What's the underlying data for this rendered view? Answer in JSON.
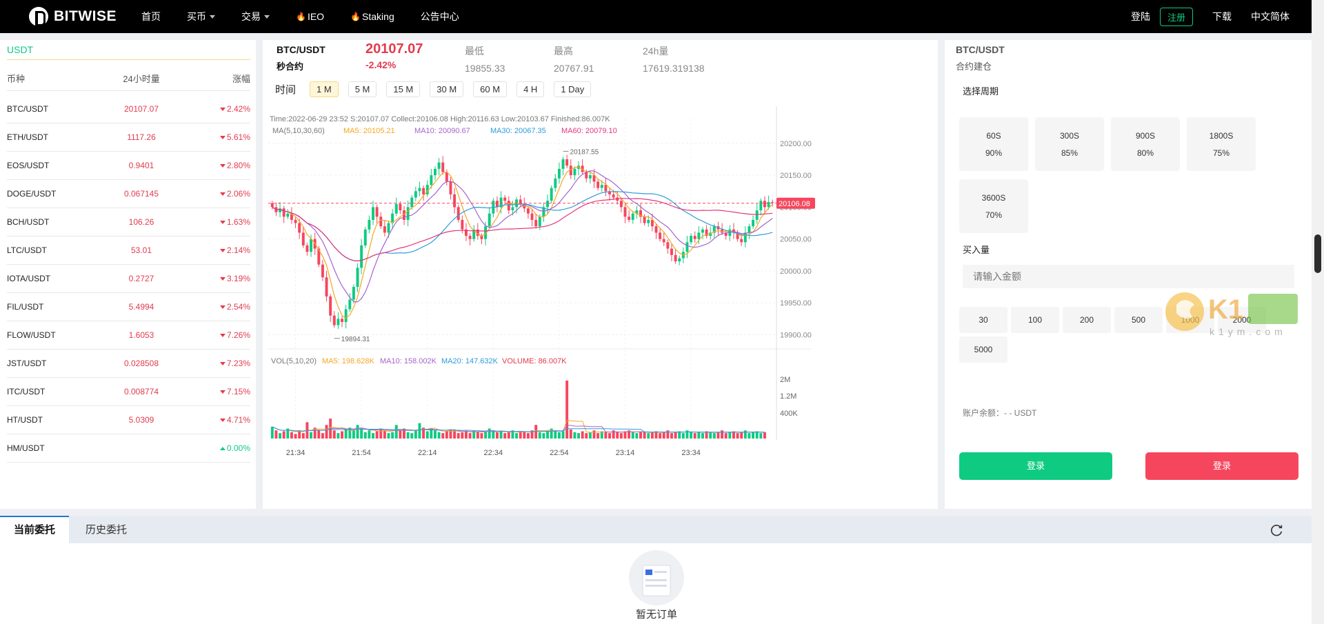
{
  "header": {
    "logo_text": "BITWISE",
    "nav": [
      {
        "label": "首页",
        "dropdown": false,
        "fire": false
      },
      {
        "label": "买币",
        "dropdown": true,
        "fire": false
      },
      {
        "label": "交易",
        "dropdown": true,
        "fire": false
      },
      {
        "label": "IEO",
        "dropdown": false,
        "fire": true
      },
      {
        "label": "Staking",
        "dropdown": false,
        "fire": true
      },
      {
        "label": "公告中心",
        "dropdown": false,
        "fire": false
      }
    ],
    "login": "登陆",
    "register": "注册",
    "download": "下载",
    "language": "中文简体"
  },
  "market": {
    "tab": "USDT",
    "headers": {
      "pair": "币种",
      "volume": "24小时量",
      "change": "涨幅"
    },
    "rows": [
      {
        "pair": "BTC/USDT",
        "price": "20107.07",
        "change": "2.42%",
        "dir": "down"
      },
      {
        "pair": "ETH/USDT",
        "price": "1117.26",
        "change": "5.61%",
        "dir": "down"
      },
      {
        "pair": "EOS/USDT",
        "price": "0.9401",
        "change": "2.80%",
        "dir": "down"
      },
      {
        "pair": "DOGE/USDT",
        "price": "0.067145",
        "change": "2.06%",
        "dir": "down"
      },
      {
        "pair": "BCH/USDT",
        "price": "106.26",
        "change": "1.63%",
        "dir": "down"
      },
      {
        "pair": "LTC/USDT",
        "price": "53.01",
        "change": "2.14%",
        "dir": "down"
      },
      {
        "pair": "IOTA/USDT",
        "price": "0.2727",
        "change": "3.19%",
        "dir": "down"
      },
      {
        "pair": "FIL/USDT",
        "price": "5.4994",
        "change": "2.54%",
        "dir": "down"
      },
      {
        "pair": "FLOW/USDT",
        "price": "1.6053",
        "change": "7.26%",
        "dir": "down"
      },
      {
        "pair": "JST/USDT",
        "price": "0.028508",
        "change": "7.23%",
        "dir": "down"
      },
      {
        "pair": "ITC/USDT",
        "price": "0.008774",
        "change": "7.15%",
        "dir": "down"
      },
      {
        "pair": "HT/USDT",
        "price": "5.0309",
        "change": "4.71%",
        "dir": "down"
      },
      {
        "pair": "HM/USDT",
        "price": "",
        "change": "0.00%",
        "dir": "up"
      }
    ]
  },
  "ticker": {
    "pair": "BTC/USDT",
    "contract": "秒合约",
    "price": "20107.07",
    "change": "-2.42%",
    "low_label": "最低",
    "low": "19855.33",
    "high_label": "最高",
    "high": "20767.91",
    "vol_label": "24h量",
    "vol": "17619.319138"
  },
  "intervals": {
    "label": "时间",
    "items": [
      "1 M",
      "5 M",
      "15 M",
      "30 M",
      "60 M",
      "4 H",
      "1 Day"
    ],
    "active": "1 M"
  },
  "chart_data": {
    "type": "candlestick",
    "info_line": "Time:2022-06-29 23:52   S:20107.07   Collect:20106.08   High:20116.63   Low:20103.67   Finished:86.007K",
    "ma_title": "MA(5,10,30,60)",
    "ma_labels": [
      {
        "text": "MA5: 20105.21",
        "color": "#f5a623"
      },
      {
        "text": "MA10: 20090.67",
        "color": "#a663cc"
      },
      {
        "text": "MA30: 20067.35",
        "color": "#2d9cdb"
      },
      {
        "text": "MA60: 20079.10",
        "color": "#e2377e"
      }
    ],
    "y_ticks": [
      20200,
      20150,
      20100,
      20050,
      20000,
      19950,
      19900
    ],
    "y_tick_labels": [
      "20200.00",
      "20150.00",
      "20100.00",
      "20050.00",
      "20000.00",
      "19950.00",
      "19900.00"
    ],
    "ylim": [
      19880,
      20215
    ],
    "current_price": 20106.08,
    "current_price_label": "20106.08",
    "high_mark": {
      "value": 20187.55,
      "label": "20187.55"
    },
    "low_mark": {
      "value": 19894.31,
      "label": "19894.31"
    },
    "x_tick_labels": [
      "21:34",
      "21:54",
      "22:14",
      "22:34",
      "22:54",
      "23:14",
      "23:34"
    ],
    "vol_title": "VOL(5,10,20)",
    "vol_labels": [
      {
        "text": "MA5: 198.628K",
        "color": "#f5a623"
      },
      {
        "text": "MA10: 158.002K",
        "color": "#a663cc"
      },
      {
        "text": "MA20: 147.632K",
        "color": "#2d9cdb"
      },
      {
        "text": "VOLUME: 86.007K",
        "color": "#e23b4e"
      }
    ],
    "vol_ticks": [
      "2M",
      "1.2M",
      "400K"
    ],
    "closes": [
      20100,
      20092,
      20098,
      20085,
      20090,
      20080,
      20075,
      20060,
      20040,
      20030,
      20050,
      20035,
      20010,
      19990,
      19960,
      19930,
      19915,
      19925,
      19920,
      19940,
      19955,
      19975,
      20005,
      20040,
      20065,
      20080,
      20100,
      20085,
      20070,
      20060,
      20075,
      20090,
      20105,
      20095,
      20080,
      20100,
      20115,
      20125,
      20130,
      20120,
      20135,
      20150,
      20160,
      20170,
      20155,
      20140,
      20120,
      20100,
      20080,
      20065,
      20055,
      20050,
      20065,
      20055,
      20050,
      20070,
      20090,
      20110,
      20100,
      20115,
      20110,
      20095,
      20100,
      20112,
      20105,
      20098,
      20090,
      20080,
      20070,
      20085,
      20100,
      20110,
      20130,
      20145,
      20160,
      20175,
      20165,
      20150,
      20160,
      20165,
      20155,
      20145,
      20150,
      20140,
      20130,
      20135,
      20125,
      20120,
      20115,
      20110,
      20100,
      20085,
      20080,
      20090,
      20095,
      20085,
      20075,
      20080,
      20070,
      20060,
      20050,
      20045,
      20035,
      20025,
      20015,
      20020,
      20030,
      20045,
      20055,
      20050,
      20060,
      20065,
      20055,
      20060,
      20070,
      20065,
      20060,
      20055,
      20065,
      20060,
      20050,
      20045,
      20060,
      20070,
      20080,
      20095,
      20110,
      20100,
      20108,
      20107
    ],
    "volumes": [
      130,
      90,
      60,
      80,
      110,
      70,
      50,
      90,
      60,
      180,
      70,
      120,
      90,
      60,
      150,
      220,
      90,
      60,
      80,
      100,
      120,
      90,
      150,
      110,
      70,
      90,
      60,
      80,
      110,
      90,
      60,
      70,
      150,
      90,
      110,
      70,
      60,
      90,
      170,
      120,
      80,
      110,
      90,
      70,
      60,
      80,
      100,
      90,
      60,
      70,
      80,
      60,
      90,
      70,
      60,
      80,
      110,
      90,
      70,
      80,
      60,
      70,
      90,
      60,
      80,
      70,
      60,
      90,
      150,
      70,
      60,
      80,
      110,
      90,
      70,
      80,
      640,
      100,
      70,
      60,
      80,
      60,
      70,
      90,
      60,
      80,
      70,
      60,
      90,
      70,
      60,
      80,
      90,
      70,
      60,
      80,
      70,
      60,
      70,
      80,
      60,
      70,
      90,
      60,
      70,
      80,
      60,
      90,
      70,
      60,
      70,
      60,
      80,
      70,
      60,
      70,
      90,
      60,
      70,
      80,
      60,
      70,
      90,
      60,
      70,
      80,
      60,
      70
    ]
  },
  "trade": {
    "pair": "BTC/USDT",
    "subtitle": "合约建仓",
    "period_label": "选择周期",
    "periods": [
      {
        "time": "60S",
        "rate": "90%"
      },
      {
        "time": "300S",
        "rate": "85%"
      },
      {
        "time": "900S",
        "rate": "80%"
      },
      {
        "time": "1800S",
        "rate": "75%"
      },
      {
        "time": "3600S",
        "rate": "70%"
      }
    ],
    "amount_label": "买入量",
    "amount_placeholder": "请输入金额",
    "amounts": [
      "30",
      "100",
      "200",
      "500",
      "1000",
      "2000",
      "5000"
    ],
    "balance": "账户余额：- - USDT",
    "buy_label": "登录",
    "sell_label": "登录"
  },
  "orders": {
    "tab_current": "当前委托",
    "tab_history": "历史委托",
    "empty": "暂无订单"
  },
  "colors": {
    "green": "#0ecb81",
    "red": "#f6465d",
    "accent": "#1f77d0"
  }
}
